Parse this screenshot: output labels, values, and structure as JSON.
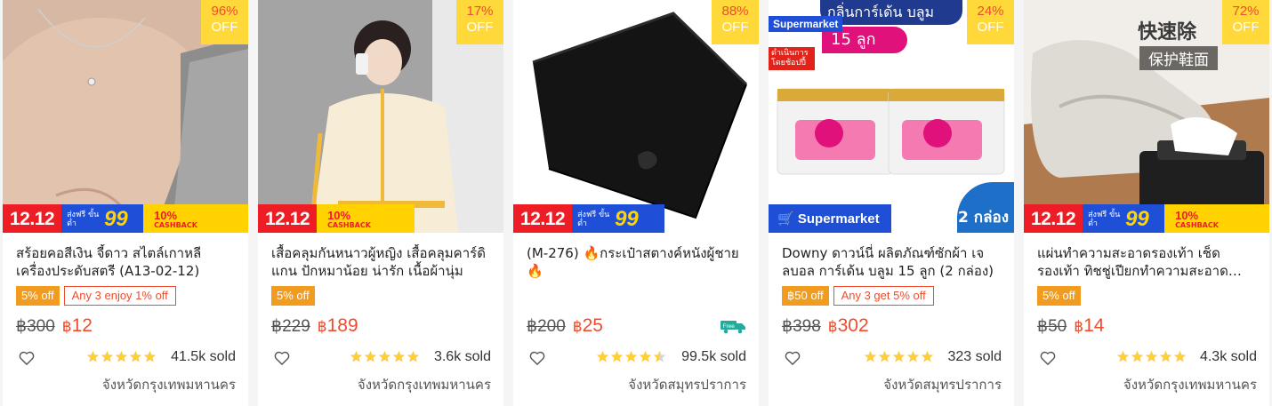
{
  "products": [
    {
      "discount_pct": "96%",
      "discount_off": "OFF",
      "promo_date": "12.12",
      "promo_ship_small": "ส่งฟรี ขั้นต่ำ",
      "promo_ship_big": "99",
      "promo_cash_top": "10%",
      "promo_cash_bottom": "CASHBACK",
      "title": "สร้อยคอสีเงิน จี้ดาว สไตล์เกาหลี เครื่องประดับสตรี (A13-02-12)",
      "tag_off": "5% off",
      "tag_any": "Any 3 enjoy 1% off",
      "old_price": "฿300",
      "currency": "฿",
      "new_price": "12",
      "rating": 5,
      "sold": "41.5k sold",
      "location": "จังหวัดกรุงเทพมหานคร",
      "heart_icon": "heart-outline-icon"
    },
    {
      "discount_pct": "17%",
      "discount_off": "OFF",
      "promo_date": "12.12",
      "promo_cash_top": "10%",
      "promo_cash_bottom": "CASHBACK",
      "title": "เสื้อคลุมกันหนาวผู้หญิง เสื้อคลุมคาร์ดิแกน ปักหมาน้อย น่ารัก เนื้อผ้านุ่ม",
      "tag_off": "5% off",
      "old_price": "฿229",
      "currency": "฿",
      "new_price": "189",
      "rating": 5,
      "sold": "3.6k sold",
      "location": "จังหวัดกรุงเทพมหานคร"
    },
    {
      "discount_pct": "88%",
      "discount_off": "OFF",
      "promo_date": "12.12",
      "promo_ship_small": "ส่งฟรี ขั้นต่ำ",
      "promo_ship_big": "99",
      "title": "(M-276) 🔥กระเป๋าสตางค์หนังผู้ชาย 🔥",
      "old_price": "฿200",
      "currency": "฿",
      "new_price": "25",
      "free_label": "Free",
      "rating": 4.5,
      "sold": "99.5k sold",
      "location": "จังหวัดสมุทรปราการ"
    },
    {
      "discount_pct": "24%",
      "discount_off": "OFF",
      "supermarket_badge": "Supermarket",
      "red_badge": "ดำเนินการโดยช้อปปี้",
      "top_banner": "กลิ่นการ์เด้น บลูม",
      "pink_banner": "15 ลูก",
      "bottom_bar": "Supermarket",
      "box_count": "2 กล่อง",
      "title": "Downy ดาวน์นี่ ผลิตภัณฑ์ซักผ้า เจลบอล การ์เด้น บลูม 15 ลูก (2 กล่อง)",
      "tag_off": "฿50 off",
      "tag_any": "Any 3 get 5% off",
      "old_price": "฿398",
      "currency": "฿",
      "new_price": "302",
      "rating": 5,
      "sold": "323 sold",
      "location": "จังหวัดสมุทรปราการ"
    },
    {
      "discount_pct": "72%",
      "discount_off": "OFF",
      "cn_text": "快速除",
      "cn_tag": "保护鞋面",
      "promo_date": "12.12",
      "promo_ship_small": "ส่งฟรี ขั้นต่ำ",
      "promo_ship_big": "99",
      "promo_cash_top": "10%",
      "promo_cash_bottom": "CASHBACK",
      "title": "แผ่นทำความสะอาดรองเท้า เช็ดรองเท้า ทิชชู่เปียกทำความสะอาดรองเท้า",
      "tag_off": "5% off",
      "old_price": "฿50",
      "currency": "฿",
      "new_price": "14",
      "rating": 5,
      "sold": "4.3k sold",
      "location": "จังหวัดกรุงเทพมหานคร"
    }
  ],
  "colors": {
    "accent": "#ee4d2d",
    "discount_bg": "#ffd839",
    "star": "#ffce3d",
    "promo_red": "#ee1c25",
    "promo_blue": "#1f4fd6",
    "promo_yellow": "#ffd200",
    "tag_orange": "#f29c1f"
  }
}
